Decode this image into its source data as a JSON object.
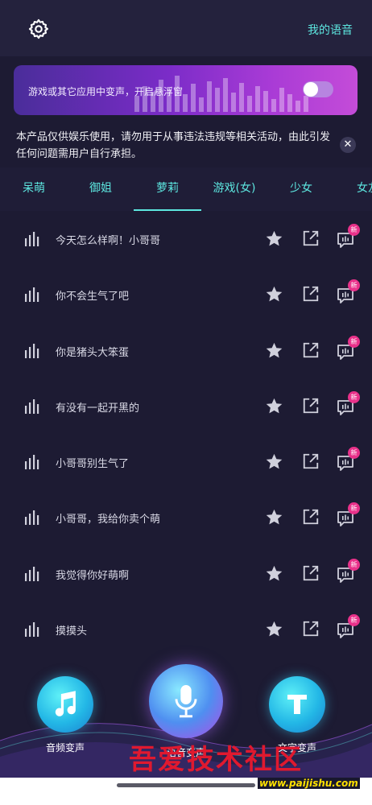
{
  "header": {
    "settings_icon": "gear-icon",
    "my_voice_link": "我的语音"
  },
  "banner": {
    "text": "游戏或其它应用中变声，开启悬浮窗",
    "toggle_on": false
  },
  "notice": {
    "text": "本产品仅供娱乐使用，请勿用于从事违法违规等相关活动，由此引发任何问题需用户自行承担。",
    "close_icon": "close-icon"
  },
  "tabs": [
    {
      "label": "呆萌"
    },
    {
      "label": "御姐"
    },
    {
      "label": "萝莉"
    },
    {
      "label": "游戏(女)"
    },
    {
      "label": "少女"
    },
    {
      "label": "女友"
    }
  ],
  "active_tab": "萝莉",
  "items": [
    {
      "label": "今天怎么样啊！小哥哥",
      "badge": "新"
    },
    {
      "label": "你不会生气了吧",
      "badge": "新"
    },
    {
      "label": "你是猪头大笨蛋",
      "badge": "新"
    },
    {
      "label": "有没有一起开黑的",
      "badge": "新"
    },
    {
      "label": "小哥哥别生气了",
      "badge": "新"
    },
    {
      "label": "小哥哥，我给你卖个萌",
      "badge": "新"
    },
    {
      "label": "我觉得你好萌啊",
      "badge": "新"
    },
    {
      "label": "摸摸头",
      "badge": "新"
    }
  ],
  "actions": {
    "audio": {
      "label": "音频变声",
      "icon": "music-note-icon"
    },
    "voice": {
      "label": "语音变声",
      "icon": "microphone-icon"
    },
    "text": {
      "label": "文字变声",
      "icon": "text-t-icon"
    }
  },
  "watermark": {
    "text": "吾爱技术社区",
    "url": "www.paijishu.com"
  },
  "colors": {
    "background": "#1d1b33",
    "accent": "#5de7e0",
    "badge": "#e9318a"
  }
}
